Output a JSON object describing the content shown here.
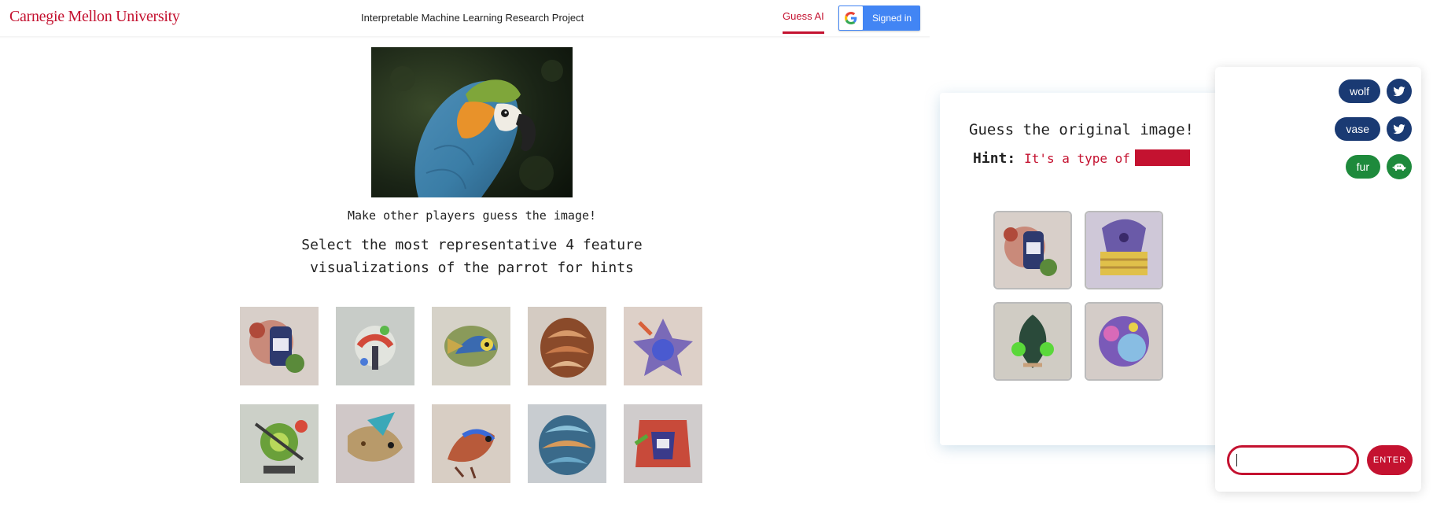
{
  "header": {
    "brand": "Carnegie Mellon University",
    "title": "Interpretable Machine Learning Research Project",
    "nav_tab": "Guess AI",
    "signin_label": "Signed in"
  },
  "main": {
    "instruction_small": "Make other players guess the image!",
    "instruction_line1": "Select the most representative 4 feature",
    "instruction_line2": "visualizations of the parrot for hints",
    "feature_count": 10
  },
  "game": {
    "title": "Guess the original image!",
    "hint_label": "Hint:",
    "hint_text": "It's a type of",
    "hint_count": 4
  },
  "chat": {
    "guesses": [
      {
        "word": "wolf",
        "icon": "bird-icon",
        "color": "#1a3a73"
      },
      {
        "word": "vase",
        "icon": "bird-icon",
        "color": "#1a3a73"
      },
      {
        "word": "fur",
        "icon": "turtle-icon",
        "color": "#1e8a3c"
      }
    ],
    "input_value": "",
    "enter_label": "ENTER"
  },
  "colors": {
    "accent": "#c41230",
    "google_blue": "#4285f4",
    "navy": "#1a3a73",
    "green": "#1e8a3c"
  }
}
